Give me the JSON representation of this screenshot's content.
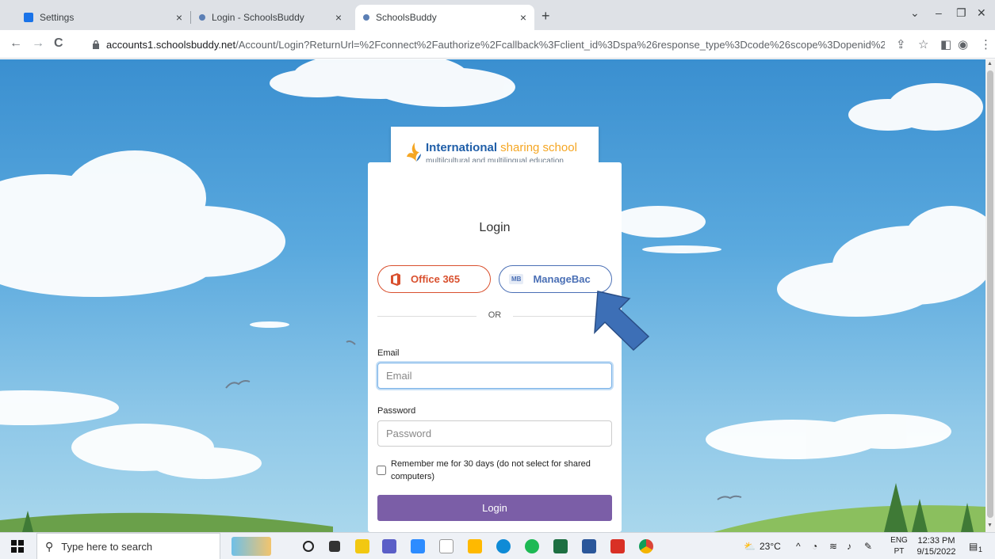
{
  "browser": {
    "tabs": [
      {
        "title": "Settings",
        "favicon_color": "#1a73e8"
      },
      {
        "title": "Login - SchoolsBuddy",
        "favicon_color": "#5b7fb5"
      },
      {
        "title": "SchoolsBuddy",
        "favicon_color": "#5b7fb5"
      }
    ],
    "close_glyph": "×",
    "new_tab_glyph": "+",
    "url_host": "accounts1.schoolsbuddy.net",
    "url_path": "/Account/Login?ReturnUrl=%2Fconnect%2Fauthorize%2Fcallback%3Fclient_id%3Dspa%26response_type%3Dcode%26scope%3Dopenid%2...",
    "nav": {
      "back": "←",
      "forward": "→",
      "reload": "C"
    },
    "toolbar_icons": {
      "share": "⇪",
      "star": "☆",
      "sidepanel": "◧",
      "profile": "◉",
      "menu": "⋮"
    },
    "window_controls": {
      "dropdown": "⌄",
      "minimize": "–",
      "restore": "❐",
      "close": "✕"
    }
  },
  "school": {
    "name_part1": "International",
    "name_part2": " sharing school",
    "tagline": "multilcultural and multilingual education"
  },
  "login": {
    "title": "Login",
    "office_label": "Office 365",
    "managebac_label": "ManageBac",
    "managebac_badge": "MB",
    "or_text": "OR",
    "email_label": "Email",
    "email_placeholder": "Email",
    "password_label": "Password",
    "password_placeholder": "Password",
    "remember_text": "Remember me for 30 days (do not select for shared computers)",
    "login_button": "Login"
  },
  "colors": {
    "office": "#d9502e",
    "managebac": "#4a6fb5",
    "login_button": "#7b5ea7",
    "arrow": "#3d6fb6"
  },
  "taskbar": {
    "search_placeholder": "Type here to search",
    "weather": "23°C",
    "lang_top": "ENG",
    "lang_bottom": "PT",
    "time": "12:33 PM",
    "date": "9/15/2022",
    "notification_count": "1"
  }
}
